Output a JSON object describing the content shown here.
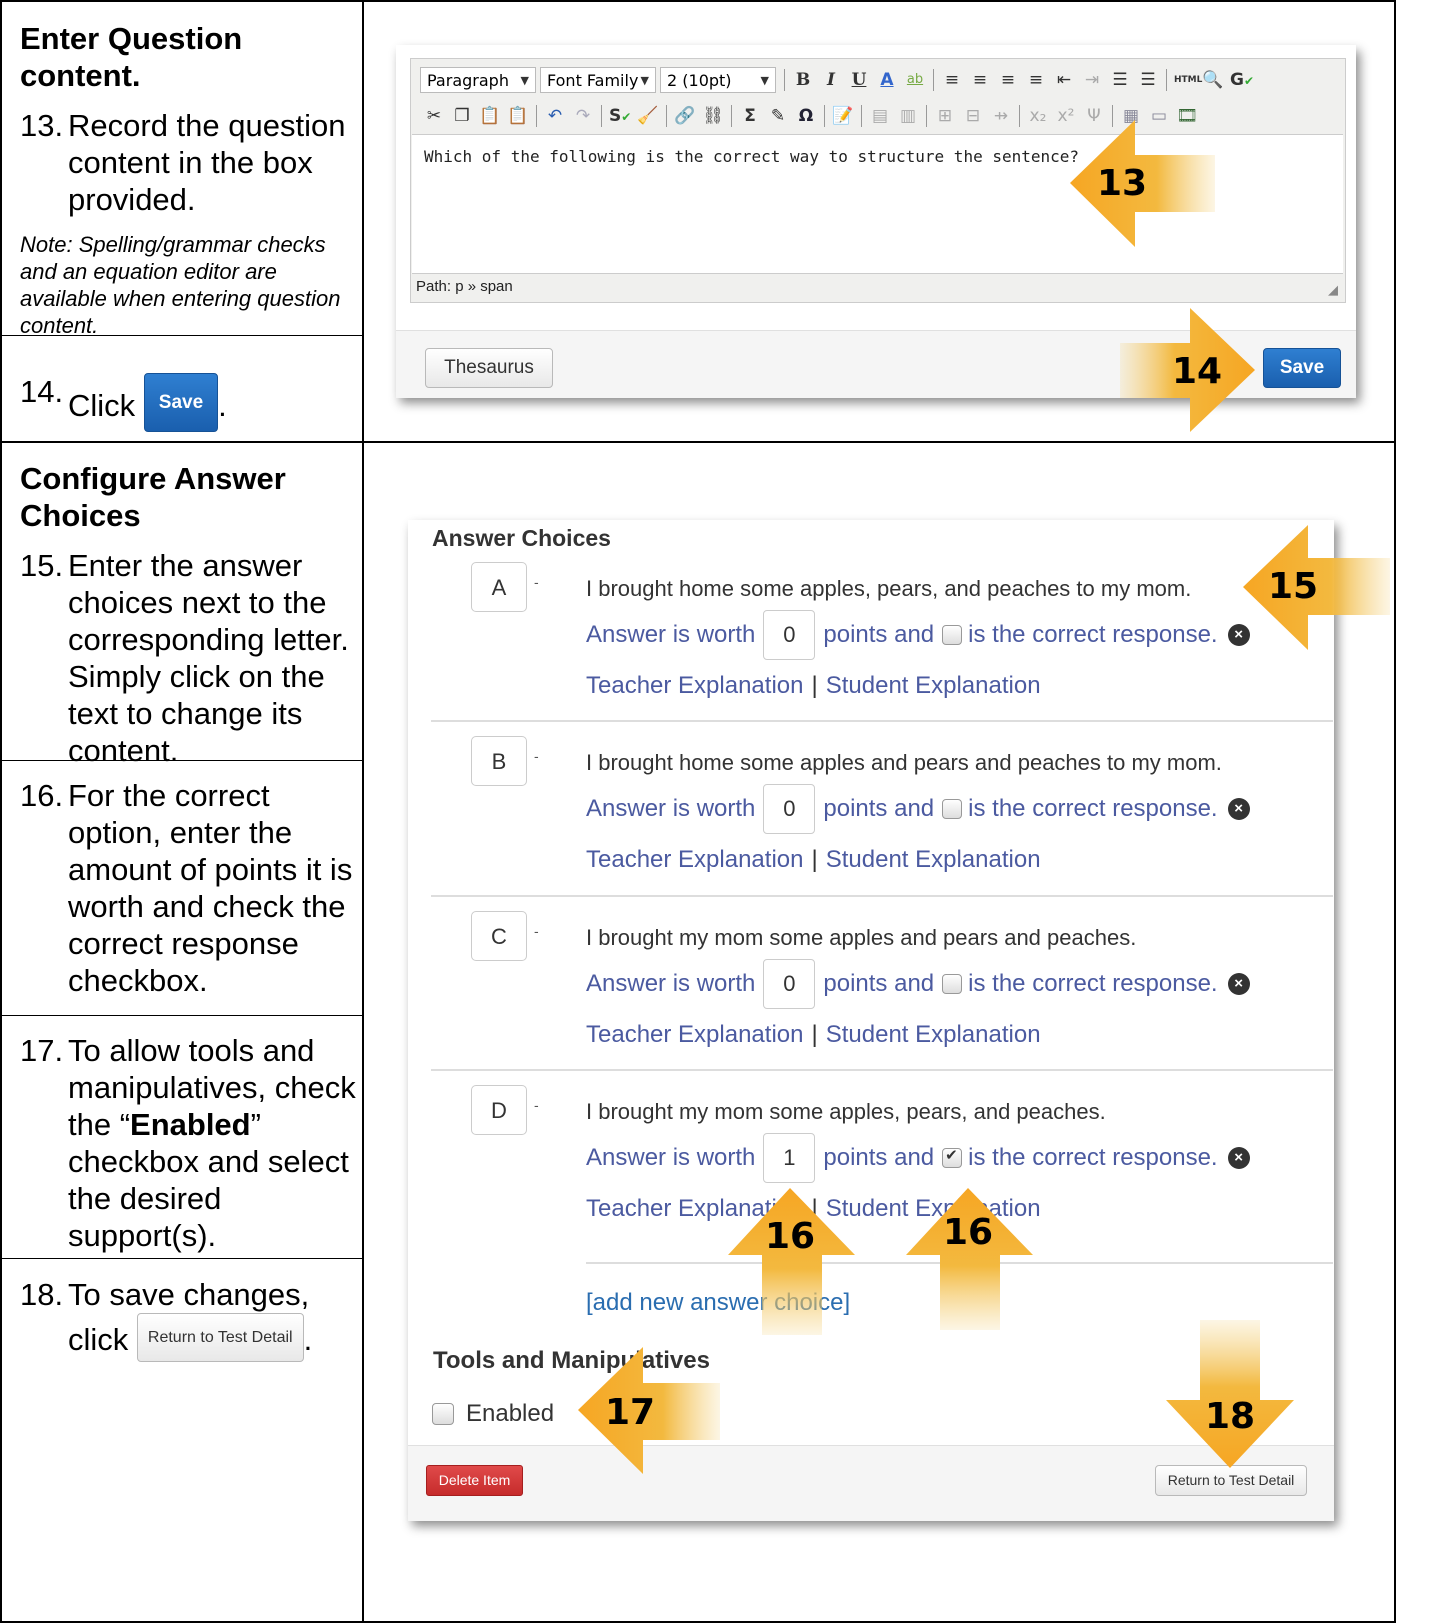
{
  "left_column": {
    "section1_heading": "Enter Question content.",
    "step13_num": "13.",
    "step13_text": "Record the question content in the box provided.",
    "note": "Note: Spelling/grammar checks and an equation editor are available when entering question content.",
    "step14_num": "14.",
    "step14_prefix": "Click",
    "step14_button": "Save",
    "step14_suffix": ".",
    "section2_heading": "Configure Answer Choices",
    "step15_num": "15.",
    "step15_text": "Enter the answer choices next to the corresponding letter. Simply click on the text to change its content.",
    "step16_num": "16.",
    "step16_text": "For the correct option, enter the amount of points it is worth and check the correct response checkbox.",
    "step17_num": "17.",
    "step17_pre": "To allow tools and manipulatives, check the “",
    "step17_bold": "Enabled",
    "step17_post": "” checkbox and select the desired support(s).",
    "step18_num": "18.",
    "step18_text": "To save changes,",
    "step18_click": "click",
    "step18_button": "Return to Test Detail",
    "step18_suffix": "."
  },
  "editor": {
    "format_select": "Paragraph",
    "font_family_select": "Font Family",
    "font_size_select": "2 (10pt)",
    "content": "Which of the following is the correct way to structure the sentence?",
    "path": "Path: p » span",
    "thesaurus_button": "Thesaurus",
    "save_button": "Save"
  },
  "callouts": {
    "c13": "13",
    "c14": "14",
    "c15": "15",
    "c16a": "16",
    "c16b": "16",
    "c17": "17",
    "c18": "18"
  },
  "answers_panel": {
    "title": "Answer Choices",
    "worth_label": "Answer is worth",
    "points_label": "points and",
    "correct_label": "is the correct response.",
    "teacher_expl": "Teacher Explanation",
    "student_expl": "Student Explanation",
    "separator": "|",
    "choices": [
      {
        "letter": "A",
        "text": "I brought home some apples, pears, and peaches to my mom.",
        "points": "0",
        "correct": false
      },
      {
        "letter": "B",
        "text": "I brought home some apples and pears and peaches to my mom.",
        "points": "0",
        "correct": false
      },
      {
        "letter": "C",
        "text": "I brought my mom some apples and pears and peaches.",
        "points": "0",
        "correct": false
      },
      {
        "letter": "D",
        "text": "I brought my mom some apples, pears, and peaches.",
        "points": "1",
        "correct": true
      }
    ],
    "add_new": "[add new answer choice]",
    "tools_title": "Tools and Manipulatives",
    "enabled_label": "Enabled",
    "delete_button": "Delete Item",
    "return_button": "Return to Test Detail"
  }
}
